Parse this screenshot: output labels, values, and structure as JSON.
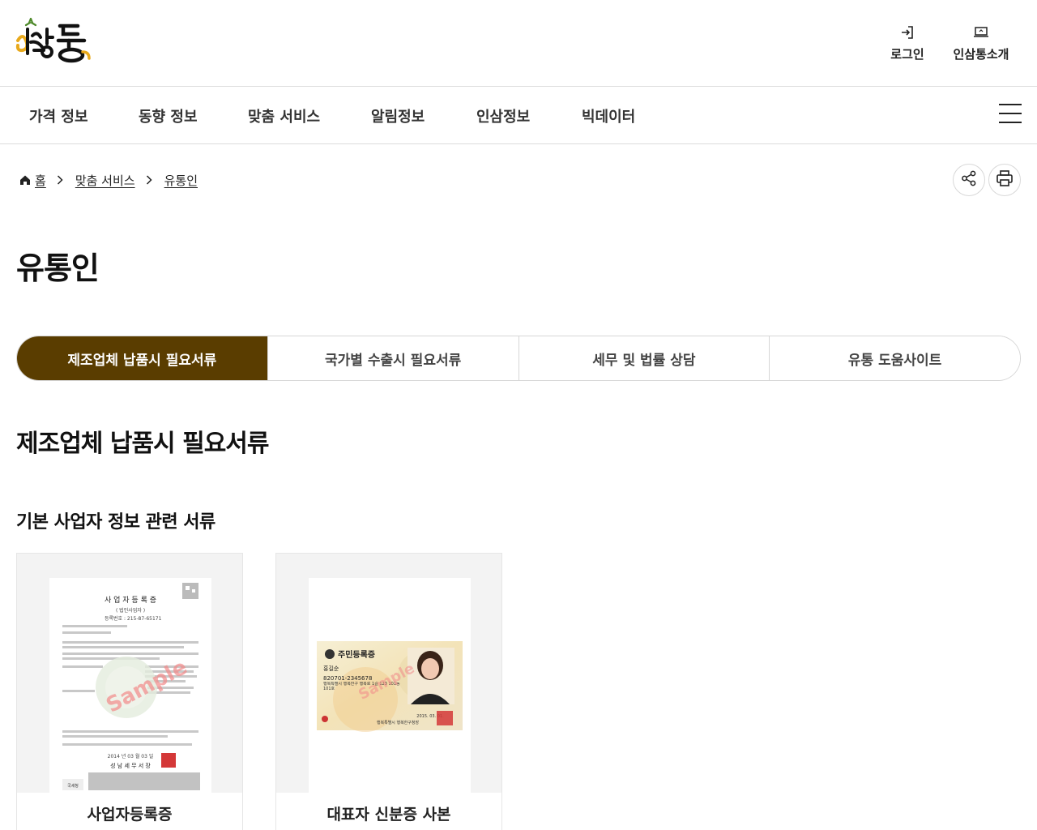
{
  "header": {
    "logo_alt": "인삼통",
    "util": [
      {
        "label": "로그인",
        "icon": "login-icon"
      },
      {
        "label": "인삼통소개",
        "icon": "laptop-icon"
      }
    ]
  },
  "gnb": {
    "items": [
      "가격 정보",
      "동향 정보",
      "맞춤 서비스",
      "알림정보",
      "인삼정보",
      "빅데이터"
    ],
    "menu_icon": "hamburger-icon"
  },
  "breadcrumb": {
    "home": "홈",
    "level1": "맞춤 서비스",
    "level2": "유통인"
  },
  "page": {
    "title": "유통인"
  },
  "tabs": [
    {
      "label": "제조업체 납품시 필요서류",
      "active": true
    },
    {
      "label": "국가별 수출시 필요서류",
      "active": false
    },
    {
      "label": "세무 및 법률 상담",
      "active": false
    },
    {
      "label": "유통 도움사이트",
      "active": false
    }
  ],
  "section": {
    "title": "제조업체 납품시 필요서류",
    "subtitle": "기본 사업자 정보 관련 서류"
  },
  "cards": [
    {
      "label": "사업자등록증",
      "doc": {
        "heading": "사 업 자 등 록 증",
        "subheading": "( 법인사업자 )",
        "reg_no": "등록번호 : 215-87-65171",
        "date": "2014 년 03 월 03 일",
        "issuer": "성 남 세 무 서 장",
        "watermark": "Sample",
        "footer_logo": "국세청"
      }
    },
    {
      "label": "대표자 신분증 사본",
      "doc": {
        "heading": "주민등록증",
        "name": "홍길순",
        "id_no": "820701-2345678",
        "address": "행복특별시 행복한구 행복로 1길 123 101동 101호",
        "date": "2015. 03. 01.",
        "issuer": "행복특별시 행복한구청장",
        "watermark": "Sample"
      }
    }
  ],
  "colors": {
    "brand_brown": "#5a3d00",
    "logo_gold": "#e8a91c",
    "logo_green": "#4f8a2b"
  }
}
